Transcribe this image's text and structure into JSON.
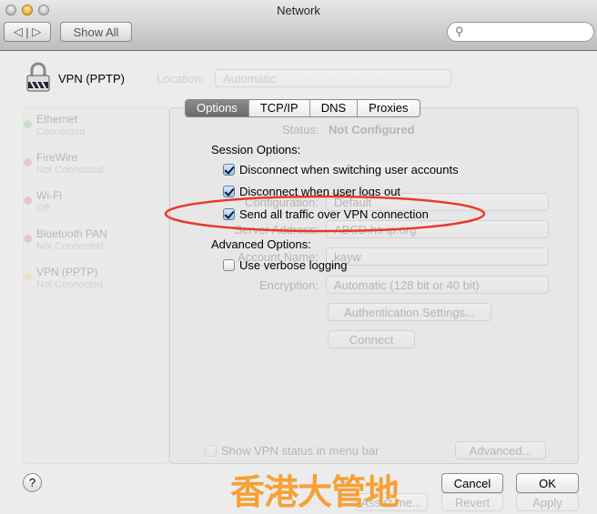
{
  "window": {
    "title": "Network"
  },
  "toolbar": {
    "show_all": "Show All",
    "search_placeholder": "",
    "search_icon": "magnifier-icon"
  },
  "header": {
    "service_name": "VPN (PPTP)",
    "location_label": "Location:",
    "location_value": "Automatic"
  },
  "sidebar": {
    "items": [
      {
        "name": "Ethernet",
        "status": "Connected",
        "color": "#5cb85c"
      },
      {
        "name": "FireWire",
        "status": "Not Connected",
        "color": "#d9534f"
      },
      {
        "name": "Wi-Fi",
        "status": "Off",
        "color": "#d9534f"
      },
      {
        "name": "Bluetooth PAN",
        "status": "Not Connected",
        "color": "#d9534f"
      },
      {
        "name": "VPN (PPTP)",
        "status": "Not Connected",
        "color": "#e8c33a"
      }
    ]
  },
  "background": {
    "status_label": "Status:",
    "status_value": "Not Configured",
    "configuration_label": "Configuration:",
    "configuration_value": "Default",
    "server_label": "Server Address:",
    "server_value": "ABCD.hs-ip.org",
    "account_label": "Account Name:",
    "account_value": "kayw",
    "encryption_label": "Encryption:",
    "encryption_value": "Automatic (128 bit or 40 bit)",
    "auth_button": "Authentication Settings...",
    "connect_button": "Connect",
    "show_vpn_status": "Show VPN status in menu bar",
    "advanced_button": "Advanced...",
    "assist_button": "Assist me...",
    "revert_button": "Revert",
    "apply_button": "Apply"
  },
  "sheet": {
    "tabs": [
      {
        "label": "Options",
        "selected": true
      },
      {
        "label": "TCP/IP"
      },
      {
        "label": "DNS"
      },
      {
        "label": "Proxies"
      }
    ],
    "session_heading": "Session Options:",
    "session_options": [
      {
        "label": "Disconnect when switching user accounts",
        "checked": true
      },
      {
        "label": "Disconnect when user logs out",
        "checked": true
      },
      {
        "label": "Send all traffic over VPN connection",
        "checked": true,
        "highlighted": true
      }
    ],
    "advanced_heading": "Advanced Options:",
    "advanced_options": [
      {
        "label": "Use verbose logging",
        "checked": false
      }
    ],
    "cancel": "Cancel",
    "ok": "OK",
    "help": "?"
  },
  "annotation": {
    "color": "#e8392b"
  },
  "watermark": "香港大管地"
}
